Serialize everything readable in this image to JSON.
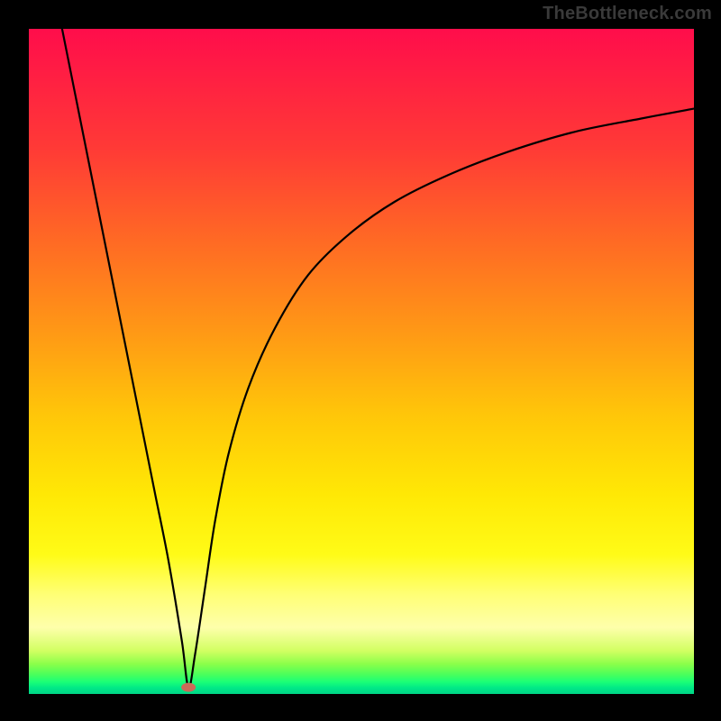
{
  "watermark": "TheBottleneck.com",
  "colors": {
    "frame_bg": "#000000",
    "curve_stroke": "#000000",
    "marker_fill": "#cc6a58",
    "gradient_stops": [
      "#ff0d4b",
      "#ff1c44",
      "#ff3a36",
      "#ff6a24",
      "#ff9a15",
      "#ffc609",
      "#ffe805",
      "#fffb17",
      "#ffff75",
      "#feffab",
      "#d2ff62",
      "#8bff4a",
      "#4dff5a",
      "#1aff77",
      "#00e887",
      "#00d586"
    ]
  },
  "chart_data": {
    "type": "line",
    "title": "",
    "xlabel": "",
    "ylabel": "",
    "xlim": [
      0,
      100
    ],
    "ylim": [
      0,
      100
    ],
    "annotations": [
      {
        "name": "marker",
        "x": 24,
        "y": 1,
        "shape": "pill",
        "color": "#cc6a58"
      }
    ],
    "series": [
      {
        "name": "left-branch",
        "x": [
          5,
          7,
          9,
          11,
          13,
          15,
          17,
          19,
          21,
          23,
          24
        ],
        "values": [
          100,
          90,
          80,
          70,
          60,
          50,
          40,
          30,
          20,
          8,
          1
        ]
      },
      {
        "name": "right-branch",
        "x": [
          24,
          25,
          26.5,
          28,
          30,
          33,
          37,
          42,
          48,
          55,
          63,
          72,
          82,
          92,
          100
        ],
        "values": [
          1,
          6,
          16,
          26,
          36,
          46,
          55,
          63,
          69,
          74,
          78,
          81.5,
          84.5,
          86.5,
          88
        ]
      }
    ]
  }
}
